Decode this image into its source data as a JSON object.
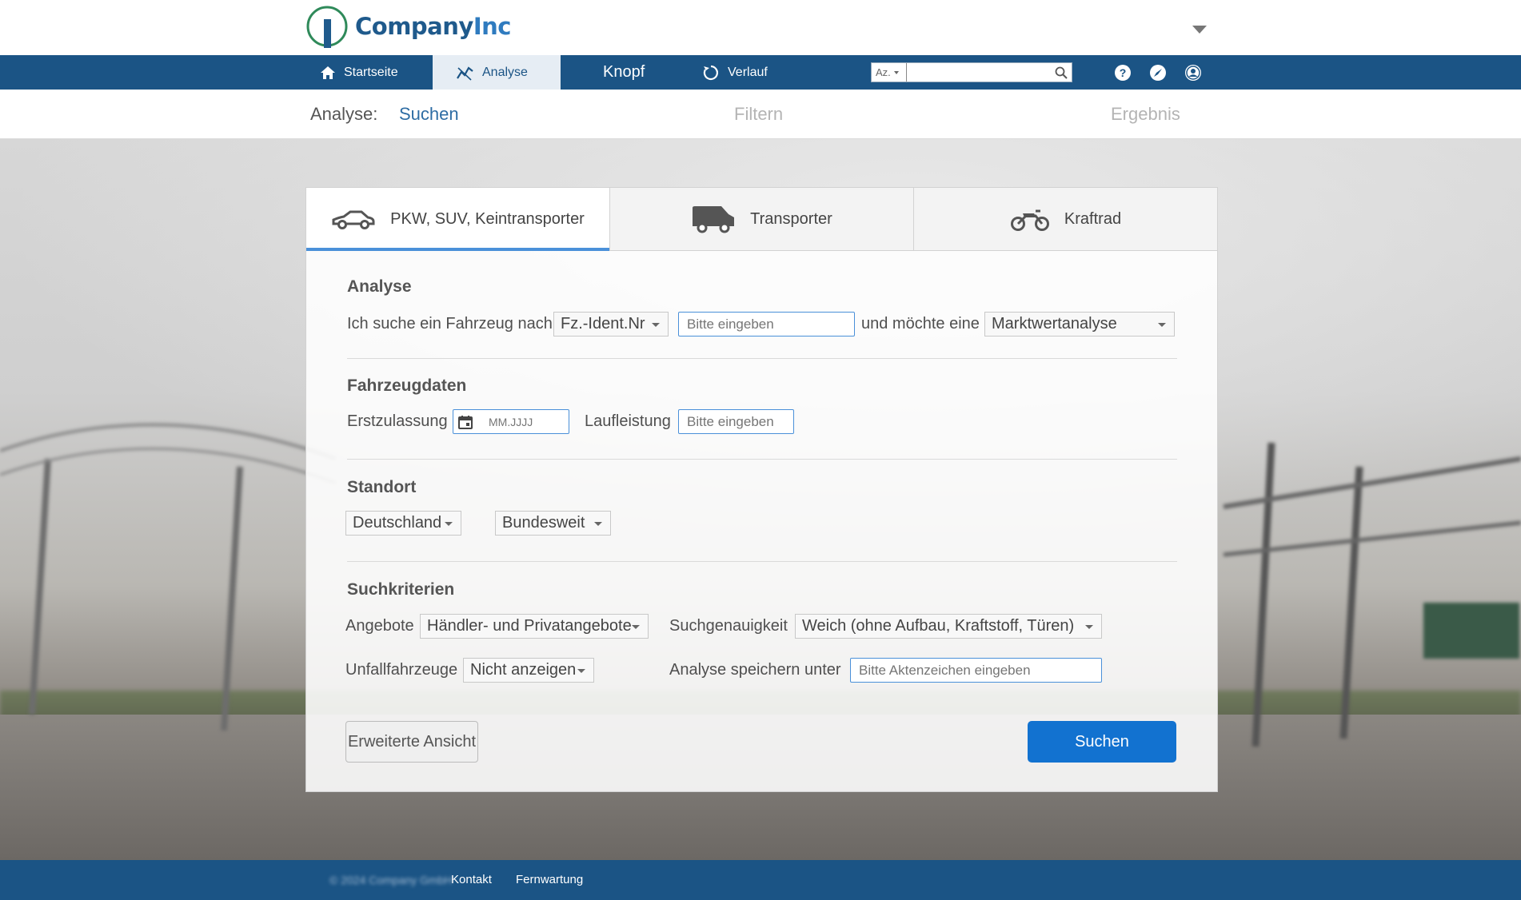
{
  "app": {
    "logo_primary": "Company",
    "logo_secondary": "Inc"
  },
  "nav": {
    "home_label": "Startseite",
    "analyse_label": "Analyse",
    "knopf_label": "Knopf",
    "verlauf_label": "Verlauf",
    "search_scope": "Az.",
    "search_value": ""
  },
  "steps": {
    "prefix": "Analyse:",
    "step1": "Suchen",
    "step2": "Filtern",
    "step3": "Ergebnis"
  },
  "tabs": [
    {
      "label": "PKW, SUV, Keintransporter",
      "icon": "car-icon",
      "active": true
    },
    {
      "label": "Transporter",
      "icon": "van-icon",
      "active": false
    },
    {
      "label": "Kraftrad",
      "icon": "motorcycle-icon",
      "active": false
    }
  ],
  "analyse": {
    "title": "Analyse",
    "text_before": "Ich suche ein Fahrzeug nach",
    "search_by": "Fz.-Ident.Nr",
    "input_placeholder": "Bitte eingeben",
    "text_middle": "und möchte eine",
    "analysis_type": "Marktwertanalyse"
  },
  "fahrzeugdaten": {
    "title": "Fahrzeugdaten",
    "erstzulassung_label": "Erstzulassung",
    "erstzulassung_placeholder": "MM.JJJJ",
    "laufleistung_label": "Laufleistung",
    "laufleistung_placeholder": "Bitte eingeben"
  },
  "standort": {
    "title": "Standort",
    "country": "Deutschland",
    "region": "Bundesweit"
  },
  "suchkriterien": {
    "title": "Suchkriterien",
    "angebote_label": "Angebote",
    "angebote_value": "Händler- und Privatangebote",
    "genauigkeit_label": "Suchgenauigkeit",
    "genauigkeit_value": "Weich (ohne Aufbau, Kraftstoff, Türen)",
    "unfall_label": "Unfallfahrzeuge",
    "unfall_value": "Nicht anzeigen",
    "speichern_label": "Analyse speichern unter",
    "speichern_placeholder": "Bitte Aktenzeichen eingeben"
  },
  "buttons": {
    "extended": "Erweiterte Ansicht",
    "search": "Suchen"
  },
  "footer": {
    "copyright": "© 2024 Company GmbH",
    "kontakt": "Kontakt",
    "fernwartung": "Fernwartung"
  },
  "colors": {
    "brand": "#1b5485",
    "primary_button": "#1272d0",
    "active_tab_underline": "#4a90d9"
  }
}
